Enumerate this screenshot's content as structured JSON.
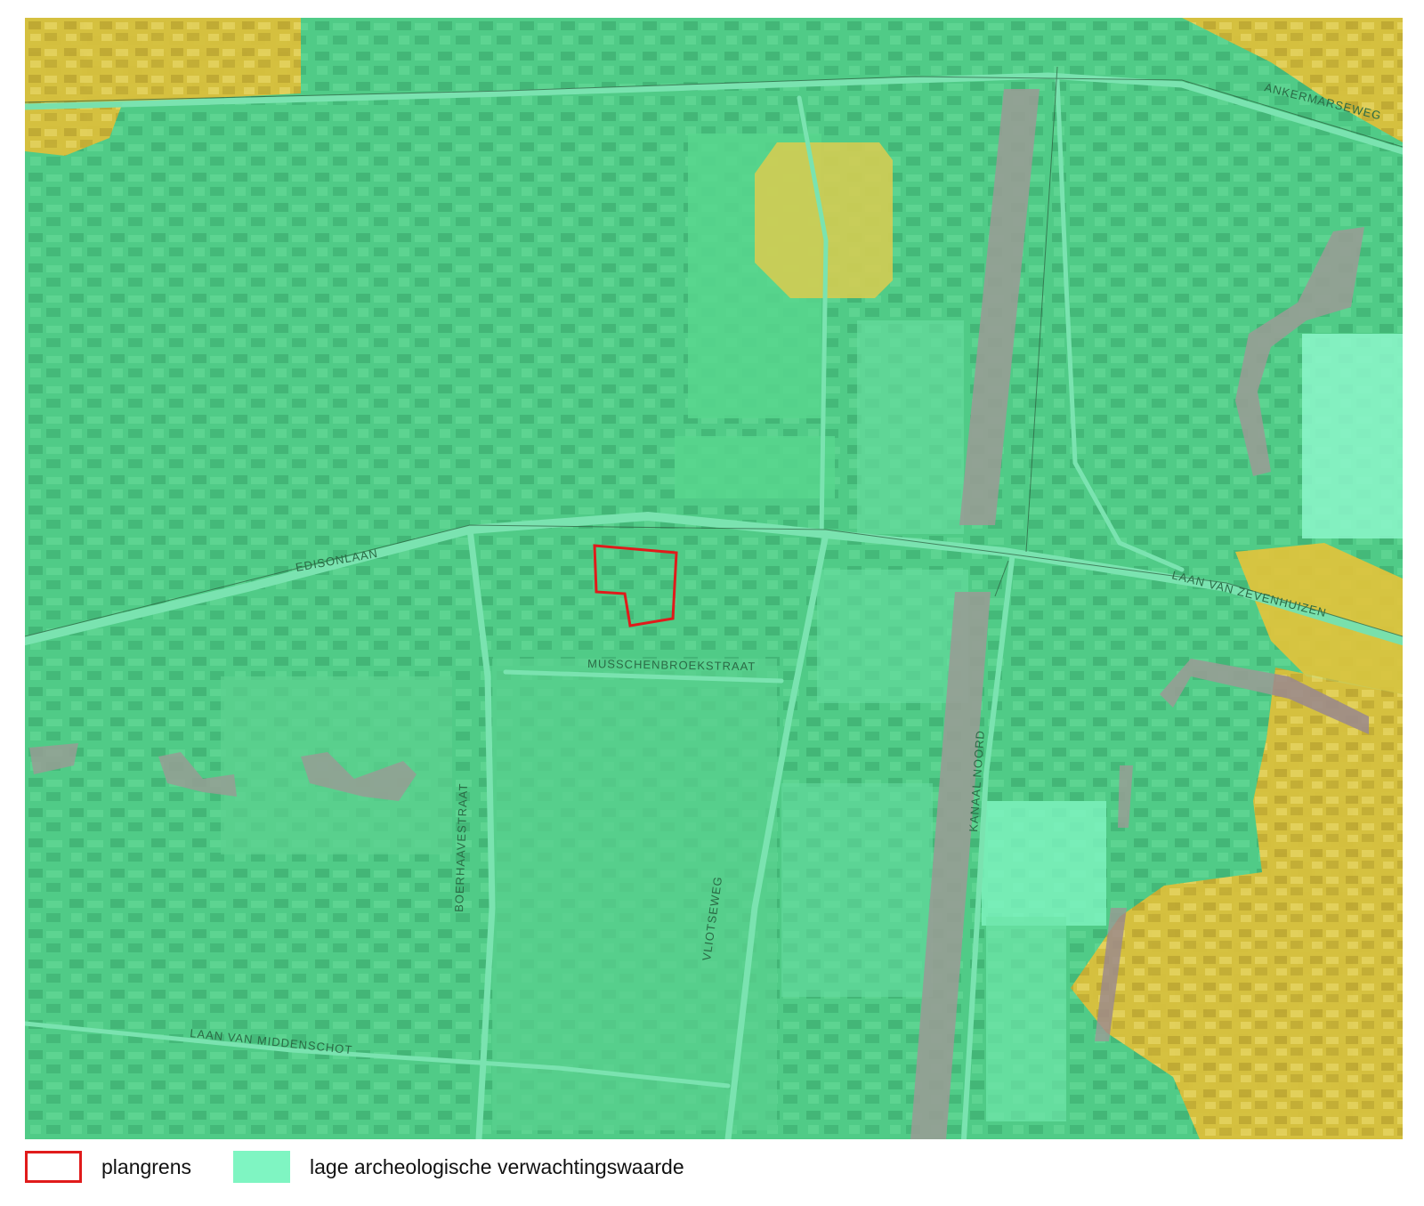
{
  "colors": {
    "low_expectation_fill": "#7ff5c2",
    "base_green": "#3fbf72",
    "high_expectation_fill": "#e6c23a",
    "water_fill": "#a08a8a",
    "plan_boundary_stroke": "#e01b1b"
  },
  "map": {
    "street_labels": [
      "ANKERMARSEWEG",
      "EDISONLAAN",
      "LAAN VAN ZEVENHUIZEN",
      "MUSSCHENBROEKSTRAAT",
      "BOERHAAVESTRAAT",
      "VLIOTSEWEG",
      "KANAAL NOORD",
      "LAAN VAN MIDDENSCHOT"
    ]
  },
  "legend": {
    "items": [
      {
        "label": "plangrens",
        "swatch": "outline-red"
      },
      {
        "label": "lage archeologische verwachtingswaarde",
        "swatch": "fill-mint"
      }
    ]
  }
}
